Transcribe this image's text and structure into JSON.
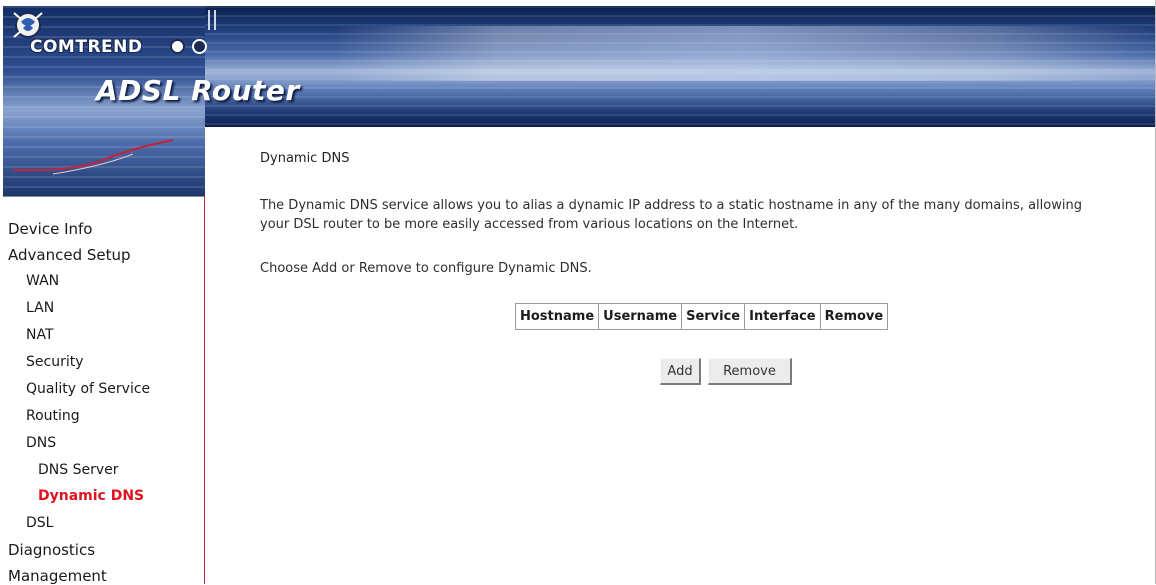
{
  "header": {
    "brand_name": "COMTREND",
    "product_title": "ADSL Router",
    "colors": {
      "banner_dark": "#0a1f4a",
      "banner_mid": "#4a6aa8",
      "accent_red": "#b52233"
    }
  },
  "sidebar": {
    "items": [
      {
        "label": "Device Info",
        "level": 0
      },
      {
        "label": "Advanced Setup",
        "level": 0
      },
      {
        "label": "WAN",
        "level": 1
      },
      {
        "label": "LAN",
        "level": 1
      },
      {
        "label": "NAT",
        "level": 1
      },
      {
        "label": "Security",
        "level": 1
      },
      {
        "label": "Quality of Service",
        "level": 1
      },
      {
        "label": "Routing",
        "level": 1
      },
      {
        "label": "DNS",
        "level": 1
      },
      {
        "label": "DNS Server",
        "level": 2
      },
      {
        "label": "Dynamic DNS",
        "level": 2,
        "active": true
      },
      {
        "label": "DSL",
        "level": 1
      },
      {
        "label": "Diagnostics",
        "level": 0
      },
      {
        "label": "Management",
        "level": 0
      }
    ],
    "active_color": "#e0141e"
  },
  "main": {
    "title": "Dynamic DNS",
    "description_line1": "The Dynamic DNS service allows you to alias a dynamic IP address to a static hostname in any of the many domains, allowing",
    "description_line2": "your DSL router to be more easily accessed from various locations on the Internet.",
    "instruction": "Choose Add or Remove to configure Dynamic DNS.",
    "table": {
      "columns": [
        "Hostname",
        "Username",
        "Service",
        "Interface",
        "Remove"
      ],
      "rows": []
    },
    "buttons": {
      "add": "Add",
      "remove": "Remove"
    }
  }
}
